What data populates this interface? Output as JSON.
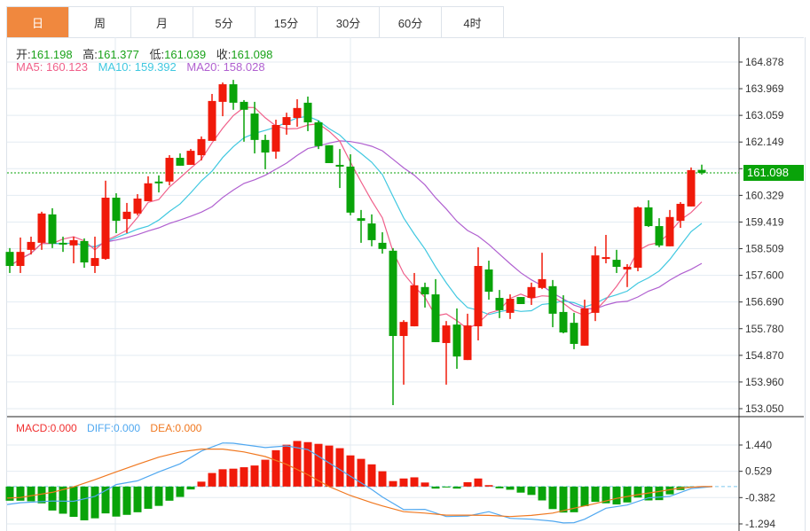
{
  "tabs": [
    {
      "label": "日",
      "active": true
    },
    {
      "label": "周"
    },
    {
      "label": "月"
    },
    {
      "label": "5分"
    },
    {
      "label": "15分"
    },
    {
      "label": "30分"
    },
    {
      "label": "60分"
    },
    {
      "label": "4时"
    }
  ],
  "ohlc_info": {
    "open_label": "开:",
    "open": "161.198",
    "high_label": "高:",
    "high": "161.377",
    "low_label": "低:",
    "low": "161.039",
    "close_label": "收:",
    "close": "161.098"
  },
  "ma_info": {
    "ma5": "MA5: 160.123",
    "ma10": "MA10: 159.392",
    "ma20": "MA20: 158.028"
  },
  "macd_info": {
    "macd": "MACD:0.000",
    "diff": "DIFF:0.000",
    "dea": "DEA:0.000"
  },
  "current_price": "161.098",
  "colors": {
    "up": "#f01a0a",
    "down": "#09a309",
    "ma5": "#f0608a",
    "ma10": "#40c8e0",
    "ma20": "#b060d0",
    "diff": "#50a8f0",
    "dea": "#f07820",
    "accent": "#f0883e"
  },
  "chart_data": {
    "type": "candlestick",
    "price_axis": {
      "ticks": [
        "164.878",
        "163.969",
        "163.059",
        "162.149",
        "161.239",
        "160.329",
        "159.419",
        "158.509",
        "157.600",
        "156.690",
        "155.780",
        "154.870",
        "153.960",
        "153.050"
      ],
      "range": [
        153.05,
        164.878
      ]
    },
    "macd_axis": {
      "ticks": [
        "1.440",
        "0.529",
        "-0.382",
        "-1.294"
      ],
      "range": [
        -1.294,
        1.44
      ]
    },
    "candles": [
      [
        158.4,
        158.53,
        157.68,
        157.92
      ],
      [
        157.92,
        158.89,
        157.68,
        158.4
      ],
      [
        158.47,
        158.92,
        158.31,
        158.74
      ],
      [
        158.71,
        159.77,
        158.47,
        159.71
      ],
      [
        159.68,
        159.89,
        158.53,
        158.68
      ],
      [
        158.71,
        158.92,
        158.4,
        158.65
      ],
      [
        158.62,
        158.92,
        158.01,
        158.8
      ],
      [
        158.77,
        158.86,
        157.86,
        158.04
      ],
      [
        157.92,
        158.92,
        157.68,
        158.19
      ],
      [
        158.16,
        160.83,
        158.13,
        160.25
      ],
      [
        160.25,
        160.4,
        159.04,
        159.46
      ],
      [
        159.52,
        160.07,
        159.04,
        159.77
      ],
      [
        159.71,
        160.37,
        159.65,
        160.22
      ],
      [
        160.13,
        160.98,
        160.13,
        160.74
      ],
      [
        160.8,
        161.01,
        160.43,
        160.74
      ],
      [
        160.8,
        161.7,
        160.67,
        161.61
      ],
      [
        161.61,
        161.76,
        161.34,
        161.34
      ],
      [
        161.37,
        161.91,
        161.37,
        161.85
      ],
      [
        161.7,
        162.34,
        161.52,
        162.25
      ],
      [
        162.19,
        163.79,
        162.19,
        163.55
      ],
      [
        163.52,
        164.18,
        163.03,
        164.12
      ],
      [
        164.12,
        164.27,
        163.25,
        163.49
      ],
      [
        163.52,
        163.58,
        162.16,
        163.25
      ],
      [
        163.12,
        163.52,
        161.76,
        162.22
      ],
      [
        162.22,
        162.4,
        161.22,
        161.79
      ],
      [
        161.82,
        162.91,
        161.58,
        162.73
      ],
      [
        162.73,
        163.15,
        162.4,
        163.0
      ],
      [
        162.97,
        163.61,
        162.67,
        163.31
      ],
      [
        163.49,
        163.7,
        162.52,
        162.82
      ],
      [
        162.82,
        162.88,
        161.91,
        162.01
      ],
      [
        162.04,
        162.04,
        161.43,
        161.43
      ],
      [
        161.37,
        161.91,
        160.58,
        161.31
      ],
      [
        161.31,
        161.73,
        159.65,
        159.74
      ],
      [
        159.55,
        159.83,
        158.71,
        159.46
      ],
      [
        159.37,
        159.68,
        158.59,
        158.8
      ],
      [
        158.71,
        159.07,
        158.34,
        158.5
      ],
      [
        158.44,
        158.53,
        153.17,
        155.53
      ],
      [
        155.53,
        156.07,
        153.87,
        156.01
      ],
      [
        155.86,
        157.68,
        155.86,
        157.26
      ],
      [
        157.2,
        157.35,
        156.5,
        156.95
      ],
      [
        156.95,
        157.47,
        155.32,
        155.32
      ],
      [
        155.29,
        156.04,
        153.87,
        155.89
      ],
      [
        155.92,
        156.47,
        154.41,
        154.83
      ],
      [
        154.71,
        156.29,
        154.71,
        155.89
      ],
      [
        155.86,
        158.56,
        155.38,
        157.92
      ],
      [
        157.8,
        158.1,
        156.77,
        157.04
      ],
      [
        156.83,
        157.1,
        156.14,
        156.41
      ],
      [
        156.32,
        156.95,
        156.11,
        156.8
      ],
      [
        156.86,
        156.86,
        156.62,
        156.62
      ],
      [
        156.83,
        157.35,
        156.59,
        157.2
      ],
      [
        157.17,
        158.37,
        157.13,
        157.47
      ],
      [
        157.23,
        157.44,
        155.83,
        156.29
      ],
      [
        156.35,
        156.92,
        155.62,
        155.65
      ],
      [
        155.98,
        156.32,
        155.08,
        155.26
      ],
      [
        155.2,
        156.77,
        155.2,
        156.47
      ],
      [
        156.32,
        158.59,
        156.04,
        158.28
      ],
      [
        158.19,
        158.98,
        158.01,
        158.22
      ],
      [
        158.13,
        158.47,
        157.68,
        157.89
      ],
      [
        157.8,
        157.98,
        157.2,
        157.89
      ],
      [
        157.86,
        159.95,
        157.74,
        159.92
      ],
      [
        159.92,
        160.16,
        159.25,
        159.28
      ],
      [
        159.28,
        159.55,
        158.56,
        158.62
      ],
      [
        158.59,
        159.83,
        158.59,
        159.59
      ],
      [
        159.46,
        160.1,
        159.22,
        160.04
      ],
      [
        159.95,
        161.28,
        159.95,
        161.19
      ],
      [
        161.198,
        161.377,
        161.039,
        161.098
      ]
    ],
    "macd_hist": [
      -0.49,
      -0.49,
      -0.51,
      -0.58,
      -0.83,
      -0.94,
      -1.05,
      -1.17,
      -1.1,
      -0.93,
      -1.04,
      -0.98,
      -0.89,
      -0.77,
      -0.67,
      -0.49,
      -0.36,
      -0.1,
      0.17,
      0.47,
      0.6,
      0.62,
      0.67,
      0.73,
      0.93,
      1.26,
      1.45,
      1.58,
      1.54,
      1.48,
      1.42,
      1.33,
      1.08,
      0.96,
      0.77,
      0.53,
      0.19,
      0.28,
      0.32,
      0.14,
      -0.07,
      -0.03,
      -0.07,
      0.15,
      0.28,
      0.05,
      -0.06,
      -0.11,
      -0.21,
      -0.29,
      -0.48,
      -0.78,
      -0.9,
      -0.89,
      -0.68,
      -0.53,
      -0.58,
      -0.62,
      -0.55,
      -0.38,
      -0.48,
      -0.47,
      -0.27,
      -0.12,
      -0.03,
      0.0
    ],
    "diff": [
      [
        0,
        -0.62
      ],
      [
        1,
        -0.56
      ],
      [
        4,
        -0.5
      ],
      [
        6,
        -0.51
      ],
      [
        8,
        -0.34
      ],
      [
        10,
        0.07
      ],
      [
        12,
        0.2
      ],
      [
        14,
        0.51
      ],
      [
        16,
        0.79
      ],
      [
        18,
        1.23
      ],
      [
        20,
        1.51
      ],
      [
        21,
        1.5
      ],
      [
        24,
        1.35
      ],
      [
        26,
        1.41
      ],
      [
        28,
        1.28
      ],
      [
        30,
        0.82
      ],
      [
        32,
        0.36
      ],
      [
        34,
        -0.1
      ],
      [
        35,
        -0.36
      ],
      [
        37,
        -0.8
      ],
      [
        39,
        -0.79
      ],
      [
        41,
        -1.04
      ],
      [
        43,
        -1.02
      ],
      [
        45,
        -0.87
      ],
      [
        47,
        -1.1
      ],
      [
        49,
        -1.13
      ],
      [
        51,
        -1.2
      ],
      [
        52,
        -1.26
      ],
      [
        53,
        -1.25
      ],
      [
        54,
        -1.13
      ],
      [
        56,
        -0.75
      ],
      [
        58,
        -0.64
      ],
      [
        60,
        -0.39
      ],
      [
        62,
        -0.34
      ],
      [
        64,
        -0.07
      ],
      [
        66,
        0.0
      ]
    ],
    "dea": [
      [
        0,
        -0.4
      ],
      [
        1,
        -0.38
      ],
      [
        4,
        -0.2
      ],
      [
        6,
        -0.01
      ],
      [
        8,
        0.24
      ],
      [
        10,
        0.51
      ],
      [
        12,
        0.77
      ],
      [
        14,
        1.02
      ],
      [
        16,
        1.2
      ],
      [
        18,
        1.3
      ],
      [
        20,
        1.3
      ],
      [
        22,
        1.2
      ],
      [
        24,
        1.04
      ],
      [
        26,
        0.77
      ],
      [
        28,
        0.41
      ],
      [
        30,
        0.0
      ],
      [
        32,
        -0.31
      ],
      [
        34,
        -0.56
      ],
      [
        35,
        -0.67
      ],
      [
        37,
        -0.87
      ],
      [
        39,
        -0.92
      ],
      [
        41,
        -0.99
      ],
      [
        43,
        -0.99
      ],
      [
        45,
        -1.0
      ],
      [
        47,
        -1.04
      ],
      [
        49,
        -1.0
      ],
      [
        51,
        -0.92
      ],
      [
        53,
        -0.75
      ],
      [
        55,
        -0.59
      ],
      [
        57,
        -0.41
      ],
      [
        59,
        -0.28
      ],
      [
        61,
        -0.17
      ],
      [
        63,
        -0.05
      ],
      [
        65,
        0.0
      ],
      [
        66,
        0.0
      ]
    ]
  }
}
